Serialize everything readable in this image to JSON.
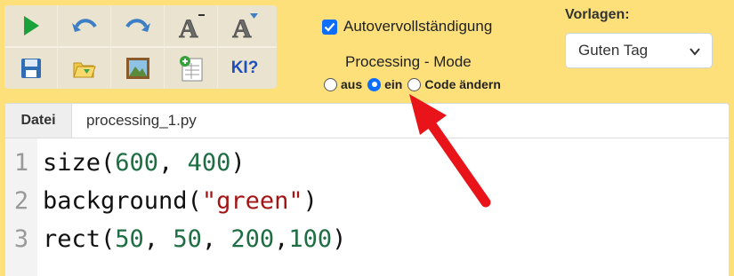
{
  "toolbar": {
    "buttons_row1": [
      {
        "icon": "run-icon",
        "label": "Run"
      },
      {
        "icon": "undo-icon",
        "label": "Undo"
      },
      {
        "icon": "redo-icon",
        "label": "Redo"
      },
      {
        "icon": "font-increase-icon",
        "label": "Larger font"
      },
      {
        "icon": "font-decrease-icon",
        "label": "Smaller font"
      }
    ],
    "buttons_row2": [
      {
        "icon": "save-icon",
        "label": "Save"
      },
      {
        "icon": "open-folder-icon",
        "label": "Open"
      },
      {
        "icon": "image-icon",
        "label": "Image"
      },
      {
        "icon": "spreadsheet-icon",
        "label": "Table"
      },
      {
        "icon": "ai-help-icon",
        "label": "KI?"
      }
    ]
  },
  "autocomplete": {
    "label": "Autovervollständigung",
    "checked": true
  },
  "processing": {
    "title": "Processing - Mode",
    "modes": [
      {
        "label": "aus",
        "selected": false
      },
      {
        "label": "ein",
        "selected": true
      },
      {
        "label": "Code ändern",
        "selected": false
      }
    ]
  },
  "templates": {
    "label": "Vorlagen:",
    "selected": "Guten Tag"
  },
  "tabs": {
    "file_menu": "Datei",
    "filename": "processing_1.py"
  },
  "editor": {
    "lines": [
      {
        "number": "1",
        "tokens": [
          {
            "t": "size(",
            "c": "plain"
          },
          {
            "t": "600",
            "c": "num"
          },
          {
            "t": ", ",
            "c": "plain"
          },
          {
            "t": "400",
            "c": "num"
          },
          {
            "t": ")",
            "c": "plain"
          }
        ]
      },
      {
        "number": "2",
        "tokens": [
          {
            "t": "background(",
            "c": "plain"
          },
          {
            "t": "\"green\"",
            "c": "str"
          },
          {
            "t": ")",
            "c": "plain"
          }
        ]
      },
      {
        "number": "3",
        "tokens": [
          {
            "t": "rect(",
            "c": "plain"
          },
          {
            "t": "50",
            "c": "num"
          },
          {
            "t": ", ",
            "c": "plain"
          },
          {
            "t": "50",
            "c": "num"
          },
          {
            "t": ", ",
            "c": "plain"
          },
          {
            "t": "200",
            "c": "num"
          },
          {
            "t": ",",
            "c": "plain"
          },
          {
            "t": "100",
            "c": "num"
          },
          {
            "t": ")",
            "c": "plain"
          }
        ]
      }
    ]
  },
  "colors": {
    "page_bg": "#fde07a",
    "accent": "#0d6efd",
    "arrow": "#e8141a"
  }
}
